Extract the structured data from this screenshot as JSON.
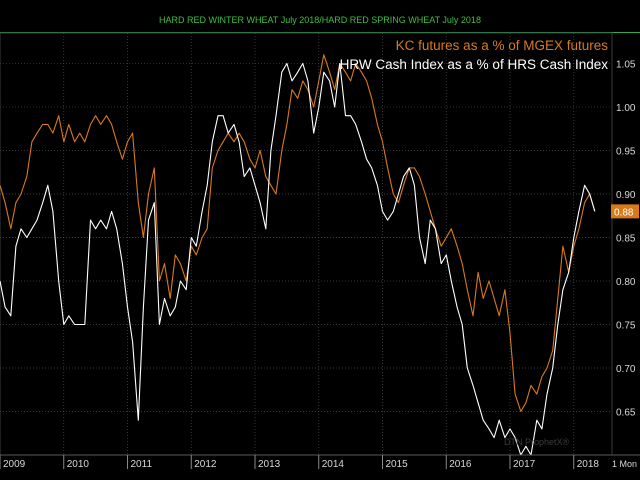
{
  "header": {
    "title": "HARD RED WINTER WHEAT July 2018/HARD RED SPRING WHEAT July 2018"
  },
  "watermark": "DTN ProphetX®",
  "period_label": "1 Mon",
  "colors": {
    "background": "#000000",
    "grid": "#4a4a4a",
    "title": "#3fbf3f",
    "kc_series": "#d97a1a",
    "hrw_series": "#ffffff",
    "axis_text": "#d8d8d8",
    "last_value_badge": "#d97a1a"
  },
  "chart_data": {
    "type": "line",
    "title": "HARD RED WINTER WHEAT July 2018/HARD RED SPRING WHEAT July 2018",
    "x_axis": {
      "type": "time",
      "tick_labels": [
        "2009",
        "2010",
        "2011",
        "2012",
        "2013",
        "2014",
        "2015",
        "2016",
        "2017",
        "2018"
      ],
      "range": [
        2009.0,
        2018.6
      ]
    },
    "y_axis": {
      "position": "right",
      "ticks": [
        0.65,
        0.7,
        0.75,
        0.8,
        0.85,
        0.9,
        0.95,
        1.0,
        1.05
      ],
      "tick_labels": [
        "0.65",
        "0.70",
        "0.75",
        "0.80",
        "0.85",
        "0.90",
        "0.95",
        "1.00",
        "1.05"
      ],
      "range": [
        0.6,
        1.085
      ]
    },
    "grid": true,
    "legend_position": "top-right",
    "last_value": {
      "label": "0.88",
      "value": 0.88,
      "color": "#d97a1a"
    },
    "series": [
      {
        "name": "KC futures as a % of MGEX futures",
        "color": "#d97a1a",
        "points": [
          [
            2009.0,
            0.91
          ],
          [
            2009.08,
            0.89
          ],
          [
            2009.17,
            0.86
          ],
          [
            2009.25,
            0.89
          ],
          [
            2009.33,
            0.9
          ],
          [
            2009.42,
            0.92
          ],
          [
            2009.5,
            0.96
          ],
          [
            2009.58,
            0.97
          ],
          [
            2009.67,
            0.98
          ],
          [
            2009.75,
            0.98
          ],
          [
            2009.83,
            0.97
          ],
          [
            2009.92,
            0.99
          ],
          [
            2010.0,
            0.96
          ],
          [
            2010.08,
            0.98
          ],
          [
            2010.17,
            0.96
          ],
          [
            2010.25,
            0.97
          ],
          [
            2010.33,
            0.96
          ],
          [
            2010.42,
            0.98
          ],
          [
            2010.5,
            0.99
          ],
          [
            2010.58,
            0.98
          ],
          [
            2010.67,
            0.99
          ],
          [
            2010.75,
            0.98
          ],
          [
            2010.83,
            0.96
          ],
          [
            2010.92,
            0.94
          ],
          [
            2011.0,
            0.96
          ],
          [
            2011.08,
            0.97
          ],
          [
            2011.17,
            0.89
          ],
          [
            2011.25,
            0.85
          ],
          [
            2011.33,
            0.9
          ],
          [
            2011.42,
            0.93
          ],
          [
            2011.5,
            0.8
          ],
          [
            2011.58,
            0.82
          ],
          [
            2011.67,
            0.78
          ],
          [
            2011.75,
            0.83
          ],
          [
            2011.83,
            0.82
          ],
          [
            2011.92,
            0.8
          ],
          [
            2012.0,
            0.84
          ],
          [
            2012.08,
            0.83
          ],
          [
            2012.17,
            0.85
          ],
          [
            2012.25,
            0.86
          ],
          [
            2012.33,
            0.93
          ],
          [
            2012.42,
            0.95
          ],
          [
            2012.5,
            0.96
          ],
          [
            2012.58,
            0.97
          ],
          [
            2012.67,
            0.96
          ],
          [
            2012.75,
            0.97
          ],
          [
            2012.83,
            0.96
          ],
          [
            2012.92,
            0.94
          ],
          [
            2013.0,
            0.93
          ],
          [
            2013.08,
            0.95
          ],
          [
            2013.17,
            0.92
          ],
          [
            2013.25,
            0.91
          ],
          [
            2013.33,
            0.9
          ],
          [
            2013.42,
            0.95
          ],
          [
            2013.5,
            0.98
          ],
          [
            2013.58,
            1.02
          ],
          [
            2013.67,
            1.01
          ],
          [
            2013.75,
            1.03
          ],
          [
            2013.83,
            1.02
          ],
          [
            2013.92,
            1.0
          ],
          [
            2014.0,
            1.03
          ],
          [
            2014.08,
            1.06
          ],
          [
            2014.17,
            1.04
          ],
          [
            2014.25,
            1.02
          ],
          [
            2014.33,
            1.05
          ],
          [
            2014.42,
            1.04
          ],
          [
            2014.5,
            1.03
          ],
          [
            2014.58,
            1.05
          ],
          [
            2014.67,
            1.04
          ],
          [
            2014.75,
            1.03
          ],
          [
            2014.83,
            1.01
          ],
          [
            2014.92,
            0.98
          ],
          [
            2015.0,
            0.96
          ],
          [
            2015.08,
            0.93
          ],
          [
            2015.17,
            0.9
          ],
          [
            2015.25,
            0.89
          ],
          [
            2015.33,
            0.91
          ],
          [
            2015.42,
            0.93
          ],
          [
            2015.5,
            0.93
          ],
          [
            2015.58,
            0.92
          ],
          [
            2015.67,
            0.9
          ],
          [
            2015.75,
            0.88
          ],
          [
            2015.83,
            0.86
          ],
          [
            2015.92,
            0.84
          ],
          [
            2016.0,
            0.85
          ],
          [
            2016.08,
            0.86
          ],
          [
            2016.17,
            0.84
          ],
          [
            2016.25,
            0.82
          ],
          [
            2016.33,
            0.79
          ],
          [
            2016.42,
            0.76
          ],
          [
            2016.5,
            0.81
          ],
          [
            2016.58,
            0.78
          ],
          [
            2016.67,
            0.8
          ],
          [
            2016.75,
            0.78
          ],
          [
            2016.83,
            0.76
          ],
          [
            2016.92,
            0.79
          ],
          [
            2017.0,
            0.74
          ],
          [
            2017.08,
            0.67
          ],
          [
            2017.17,
            0.65
          ],
          [
            2017.25,
            0.66
          ],
          [
            2017.33,
            0.68
          ],
          [
            2017.42,
            0.67
          ],
          [
            2017.5,
            0.69
          ],
          [
            2017.58,
            0.7
          ],
          [
            2017.67,
            0.72
          ],
          [
            2017.75,
            0.78
          ],
          [
            2017.83,
            0.84
          ],
          [
            2017.92,
            0.81
          ],
          [
            2018.0,
            0.84
          ],
          [
            2018.08,
            0.86
          ],
          [
            2018.17,
            0.89
          ],
          [
            2018.25,
            0.9
          ],
          [
            2018.33,
            0.88
          ]
        ]
      },
      {
        "name": "HRW Cash Index as a % of HRS Cash Index",
        "color": "#ffffff",
        "points": [
          [
            2009.0,
            0.8
          ],
          [
            2009.08,
            0.77
          ],
          [
            2009.17,
            0.76
          ],
          [
            2009.25,
            0.84
          ],
          [
            2009.33,
            0.86
          ],
          [
            2009.42,
            0.85
          ],
          [
            2009.5,
            0.86
          ],
          [
            2009.58,
            0.87
          ],
          [
            2009.67,
            0.89
          ],
          [
            2009.75,
            0.91
          ],
          [
            2009.83,
            0.88
          ],
          [
            2009.92,
            0.8
          ],
          [
            2010.0,
            0.75
          ],
          [
            2010.08,
            0.76
          ],
          [
            2010.17,
            0.75
          ],
          [
            2010.25,
            0.75
          ],
          [
            2010.33,
            0.75
          ],
          [
            2010.42,
            0.87
          ],
          [
            2010.5,
            0.86
          ],
          [
            2010.58,
            0.87
          ],
          [
            2010.67,
            0.86
          ],
          [
            2010.75,
            0.88
          ],
          [
            2010.83,
            0.86
          ],
          [
            2010.92,
            0.82
          ],
          [
            2011.0,
            0.77
          ],
          [
            2011.08,
            0.73
          ],
          [
            2011.17,
            0.64
          ],
          [
            2011.25,
            0.77
          ],
          [
            2011.33,
            0.87
          ],
          [
            2011.42,
            0.89
          ],
          [
            2011.5,
            0.75
          ],
          [
            2011.58,
            0.78
          ],
          [
            2011.67,
            0.76
          ],
          [
            2011.75,
            0.77
          ],
          [
            2011.83,
            0.8
          ],
          [
            2011.92,
            0.79
          ],
          [
            2012.0,
            0.85
          ],
          [
            2012.08,
            0.84
          ],
          [
            2012.17,
            0.88
          ],
          [
            2012.25,
            0.91
          ],
          [
            2012.33,
            0.96
          ],
          [
            2012.42,
            0.99
          ],
          [
            2012.5,
            0.99
          ],
          [
            2012.58,
            0.97
          ],
          [
            2012.67,
            0.98
          ],
          [
            2012.75,
            0.96
          ],
          [
            2012.83,
            0.92
          ],
          [
            2012.92,
            0.93
          ],
          [
            2013.0,
            0.91
          ],
          [
            2013.08,
            0.89
          ],
          [
            2013.17,
            0.86
          ],
          [
            2013.25,
            0.95
          ],
          [
            2013.33,
            0.99
          ],
          [
            2013.42,
            1.04
          ],
          [
            2013.5,
            1.05
          ],
          [
            2013.58,
            1.03
          ],
          [
            2013.67,
            1.04
          ],
          [
            2013.75,
            1.05
          ],
          [
            2013.83,
            1.03
          ],
          [
            2013.92,
            0.97
          ],
          [
            2014.0,
            1.0
          ],
          [
            2014.08,
            1.04
          ],
          [
            2014.17,
            1.03
          ],
          [
            2014.25,
            1.0
          ],
          [
            2014.33,
            1.05
          ],
          [
            2014.42,
            0.99
          ],
          [
            2014.5,
            0.99
          ],
          [
            2014.58,
            0.98
          ],
          [
            2014.67,
            0.96
          ],
          [
            2014.75,
            0.94
          ],
          [
            2014.83,
            0.93
          ],
          [
            2014.92,
            0.91
          ],
          [
            2015.0,
            0.88
          ],
          [
            2015.08,
            0.87
          ],
          [
            2015.17,
            0.88
          ],
          [
            2015.25,
            0.9
          ],
          [
            2015.33,
            0.92
          ],
          [
            2015.42,
            0.93
          ],
          [
            2015.5,
            0.91
          ],
          [
            2015.58,
            0.85
          ],
          [
            2015.67,
            0.82
          ],
          [
            2015.75,
            0.87
          ],
          [
            2015.83,
            0.86
          ],
          [
            2015.92,
            0.82
          ],
          [
            2016.0,
            0.83
          ],
          [
            2016.08,
            0.8
          ],
          [
            2016.17,
            0.77
          ],
          [
            2016.25,
            0.75
          ],
          [
            2016.33,
            0.7
          ],
          [
            2016.42,
            0.68
          ],
          [
            2016.5,
            0.66
          ],
          [
            2016.58,
            0.64
          ],
          [
            2016.67,
            0.63
          ],
          [
            2016.75,
            0.62
          ],
          [
            2016.83,
            0.64
          ],
          [
            2016.92,
            0.62
          ],
          [
            2017.0,
            0.63
          ],
          [
            2017.08,
            0.62
          ],
          [
            2017.17,
            0.6
          ],
          [
            2017.25,
            0.61
          ],
          [
            2017.33,
            0.6
          ],
          [
            2017.42,
            0.64
          ],
          [
            2017.5,
            0.63
          ],
          [
            2017.58,
            0.67
          ],
          [
            2017.67,
            0.7
          ],
          [
            2017.75,
            0.75
          ],
          [
            2017.83,
            0.79
          ],
          [
            2017.92,
            0.81
          ],
          [
            2018.0,
            0.85
          ],
          [
            2018.08,
            0.88
          ],
          [
            2018.17,
            0.91
          ],
          [
            2018.25,
            0.9
          ],
          [
            2018.33,
            0.88
          ]
        ]
      }
    ]
  }
}
